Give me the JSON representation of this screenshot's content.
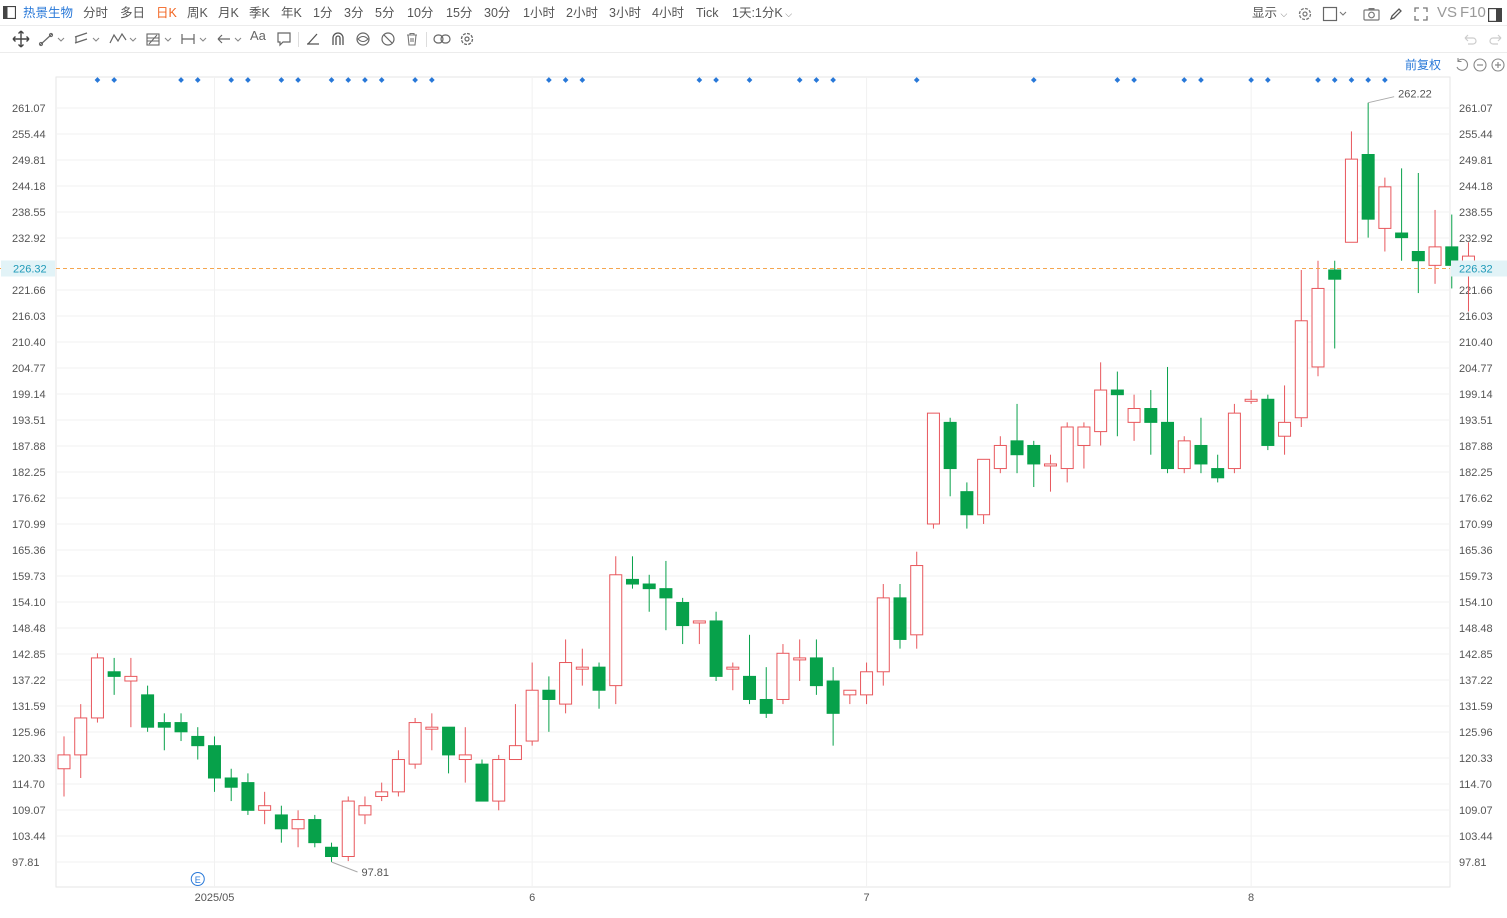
{
  "toolbar": {
    "stock_name": "热景生物",
    "periods": [
      "分时",
      "多日",
      "日K",
      "周K",
      "月K",
      "季K",
      "年K",
      "1分",
      "3分",
      "5分",
      "10分",
      "15分",
      "30分",
      "1小时",
      "2小时",
      "3小时",
      "4小时",
      "Tick",
      "1天:1分K"
    ],
    "active_period": "日K",
    "display_label": "显示",
    "vs_label": "VS",
    "f10_label": "F10",
    "adjust_label": "前复权"
  },
  "colors": {
    "up": "#e8575c",
    "down": "#07a14a",
    "accent": "#2878d8",
    "active": "#f26522",
    "current_line": "#f5a64f",
    "current_label_bg": "#e2f3f7"
  },
  "icons": [
    "menu-icon",
    "move-icon",
    "line-icon",
    "channel-icon",
    "wave-icon",
    "fib-icon",
    "measure-icon",
    "arrow-icon",
    "text-icon",
    "note-icon",
    "pen-icon",
    "magnet-icon",
    "eye-icon",
    "hide-icon",
    "trash-icon",
    "link-icon",
    "settings-icon",
    "camera-icon",
    "draw-icon",
    "fullscreen-icon",
    "panel-icon",
    "undo-icon",
    "zoom-out-icon",
    "zoom-in-icon"
  ],
  "chart_data": {
    "type": "candlestick",
    "y_ticks": [
      "261.07",
      "255.44",
      "249.81",
      "244.18",
      "238.55",
      "232.92",
      "221.66",
      "216.03",
      "210.40",
      "204.77",
      "199.14",
      "193.51",
      "187.88",
      "182.25",
      "176.62",
      "170.99",
      "165.36",
      "159.73",
      "154.10",
      "148.48",
      "142.85",
      "137.22",
      "131.59",
      "125.96",
      "120.33",
      "114.70",
      "109.07",
      "103.44",
      "97.81"
    ],
    "ylim": [
      97.81,
      261.07
    ],
    "current_price": "226.32",
    "x_labels": [
      {
        "label": "2025/05",
        "index": 9
      },
      {
        "label": "6",
        "index": 28
      },
      {
        "label": "7",
        "index": 48
      },
      {
        "label": "8",
        "index": 71
      }
    ],
    "high_annotation": "262.22",
    "low_annotation": "97.81",
    "event_marker": "E",
    "event_index": 8,
    "dot_indices": [
      2,
      3,
      7,
      8,
      10,
      11,
      13,
      14,
      16,
      17,
      18,
      19,
      21,
      22,
      29,
      30,
      31,
      38,
      39,
      41,
      44,
      45,
      46,
      51,
      58,
      63,
      64,
      67,
      68,
      71,
      72,
      75,
      76,
      77,
      78,
      79
    ],
    "candles": [
      [
        118,
        121,
        112,
        125
      ],
      [
        121,
        129,
        116,
        132
      ],
      [
        129,
        142,
        128,
        143
      ],
      [
        139,
        138,
        134,
        142
      ],
      [
        137,
        138,
        127,
        142
      ],
      [
        134,
        127,
        126,
        136
      ],
      [
        128,
        127,
        122,
        130
      ],
      [
        128,
        126,
        124,
        130
      ],
      [
        125,
        123,
        120,
        127
      ],
      [
        123,
        116,
        113,
        125
      ],
      [
        116,
        114,
        111,
        118
      ],
      [
        115,
        109,
        108,
        117
      ],
      [
        109,
        110,
        106,
        113
      ],
      [
        108,
        105,
        102,
        110
      ],
      [
        105,
        107,
        101,
        109
      ],
      [
        107,
        102,
        101,
        108
      ],
      [
        101,
        99,
        97.81,
        102
      ],
      [
        99,
        111,
        98,
        112
      ],
      [
        108,
        110,
        106,
        112
      ],
      [
        112,
        113,
        111,
        115
      ],
      [
        113,
        120,
        112,
        122
      ],
      [
        119,
        128,
        118,
        129
      ],
      [
        127,
        127,
        122,
        130
      ],
      [
        127,
        121,
        117,
        127
      ],
      [
        120,
        121,
        115,
        127
      ],
      [
        119,
        111,
        111,
        120
      ],
      [
        111,
        120,
        109,
        121
      ],
      [
        120,
        123,
        120,
        132
      ],
      [
        124,
        135,
        123,
        141
      ],
      [
        135,
        133,
        126,
        138
      ],
      [
        132,
        141,
        130,
        146
      ],
      [
        140,
        140,
        136,
        144
      ],
      [
        140,
        135,
        131,
        141
      ],
      [
        136,
        160,
        132,
        164
      ],
      [
        159,
        158,
        157,
        164
      ],
      [
        158,
        157,
        152,
        160
      ],
      [
        157,
        155,
        148,
        163
      ],
      [
        154,
        149,
        145,
        155
      ],
      [
        150,
        150,
        145,
        150
      ],
      [
        150,
        138,
        137,
        152
      ],
      [
        140,
        140,
        135,
        141
      ],
      [
        138,
        133,
        132,
        147
      ],
      [
        133,
        130,
        129,
        140
      ],
      [
        133,
        143,
        132,
        145
      ],
      [
        142,
        142,
        137,
        146
      ],
      [
        142,
        136,
        134,
        146
      ],
      [
        137,
        130,
        123,
        140
      ],
      [
        134,
        135,
        132,
        135
      ],
      [
        134,
        139,
        132,
        141
      ],
      [
        139,
        155,
        136,
        158
      ],
      [
        155,
        146,
        144,
        158
      ],
      [
        147,
        162,
        144,
        165
      ],
      [
        171,
        195,
        170,
        195
      ],
      [
        193,
        183,
        177,
        194
      ],
      [
        178,
        173,
        170,
        180
      ],
      [
        173,
        185,
        171,
        185
      ],
      [
        183,
        188,
        182,
        190
      ],
      [
        189,
        186,
        182,
        197
      ],
      [
        188,
        184,
        179,
        189
      ],
      [
        184,
        184,
        178,
        186
      ],
      [
        183,
        192,
        180,
        193
      ],
      [
        188,
        192,
        183,
        193
      ],
      [
        191,
        200,
        188,
        206
      ],
      [
        200,
        199,
        190,
        204
      ],
      [
        193,
        196,
        189,
        199
      ],
      [
        196,
        193,
        186,
        200
      ],
      [
        193,
        183,
        182,
        205
      ],
      [
        183,
        189,
        182,
        190
      ],
      [
        188,
        184,
        182,
        194
      ],
      [
        183,
        181,
        180,
        186
      ],
      [
        183,
        195,
        182,
        197
      ],
      [
        198,
        198,
        197,
        200
      ],
      [
        198,
        188,
        187,
        199
      ],
      [
        190,
        193,
        186,
        201
      ],
      [
        194,
        215,
        192,
        226
      ],
      [
        205,
        222,
        203,
        228
      ],
      [
        226,
        224,
        209,
        228
      ],
      [
        232,
        250,
        232,
        256
      ],
      [
        251,
        237,
        233,
        262.22
      ],
      [
        235,
        244,
        230,
        246
      ],
      [
        234,
        233,
        228,
        248
      ],
      [
        230,
        228,
        221,
        247
      ],
      [
        227,
        231,
        223,
        239
      ],
      [
        231,
        227,
        222,
        238
      ],
      [
        225,
        229,
        217,
        232
      ]
    ]
  }
}
